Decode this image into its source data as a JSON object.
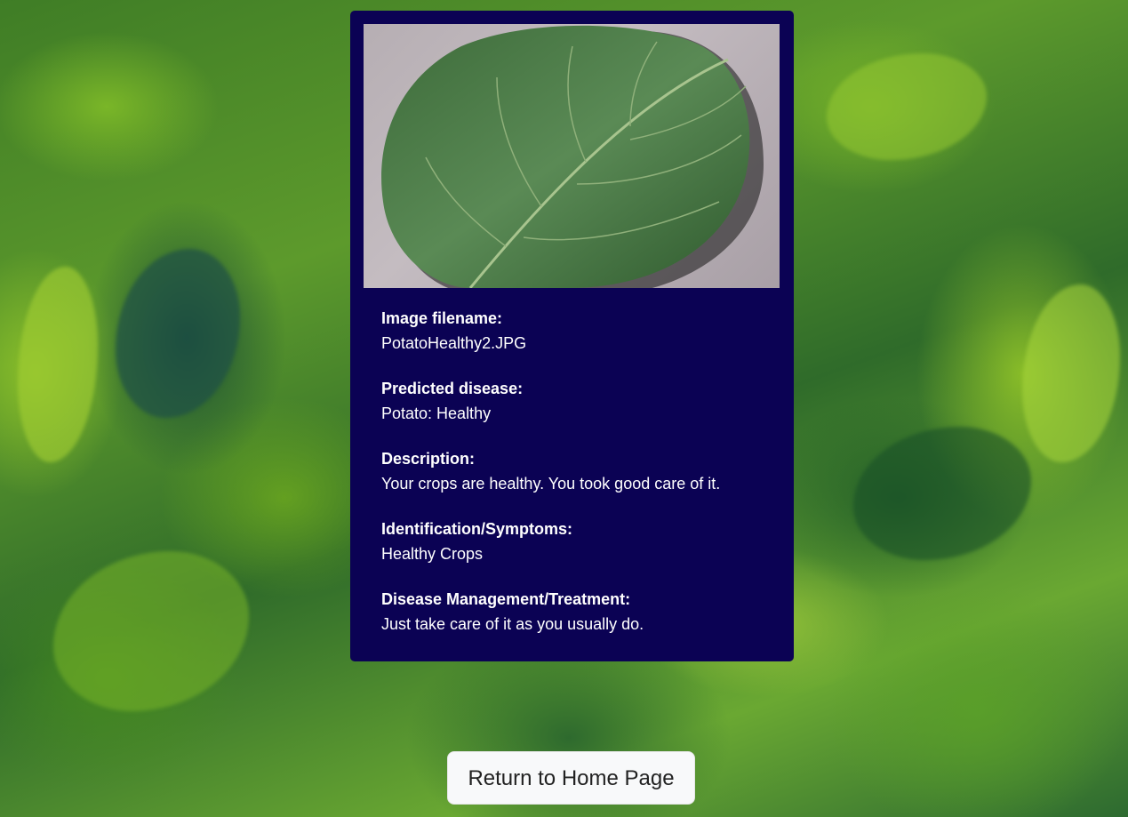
{
  "result": {
    "image_alt": "potato leaf",
    "fields": [
      {
        "label": "Image filename:",
        "value": "PotatoHealthy2.JPG"
      },
      {
        "label": "Predicted disease:",
        "value": "Potato: Healthy"
      },
      {
        "label": "Description:",
        "value": "Your crops are healthy. You took good care of it."
      },
      {
        "label": "Identification/Symptoms:",
        "value": "Healthy Crops"
      },
      {
        "label": "Disease Management/Treatment:",
        "value": "Just take care of it as you usually do."
      }
    ]
  },
  "actions": {
    "home_button_label": "Return to Home Page"
  },
  "colors": {
    "card_background": "#0b0254",
    "button_background": "#f8f9fa",
    "text_on_card": "#ffffff"
  }
}
